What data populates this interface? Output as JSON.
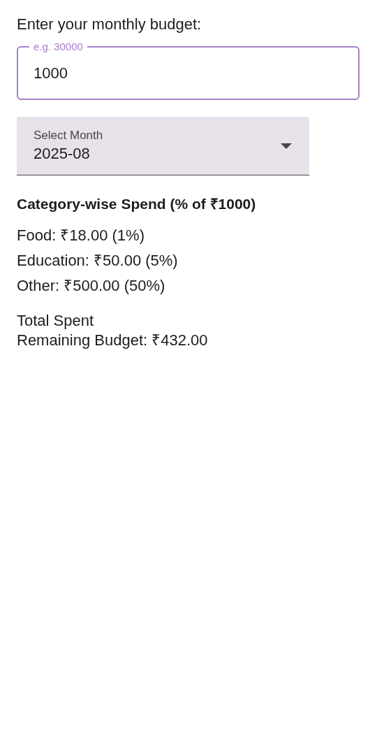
{
  "budget_prompt": "Enter your monthly budget:",
  "budget_field": {
    "label": "e.g. 30000",
    "value": "1000"
  },
  "month_select": {
    "label": "Select Month",
    "value": "2025-08"
  },
  "category_heading": "Category-wise Spend (% of ₹1000)",
  "categories": [
    "Food: ₹18.00 (1%)",
    "Education: ₹50.00 (5%)",
    "Other: ₹500.00 (50%)"
  ],
  "total_spent": "Total Spent",
  "remaining_budget": "Remaining Budget: ₹432.00"
}
